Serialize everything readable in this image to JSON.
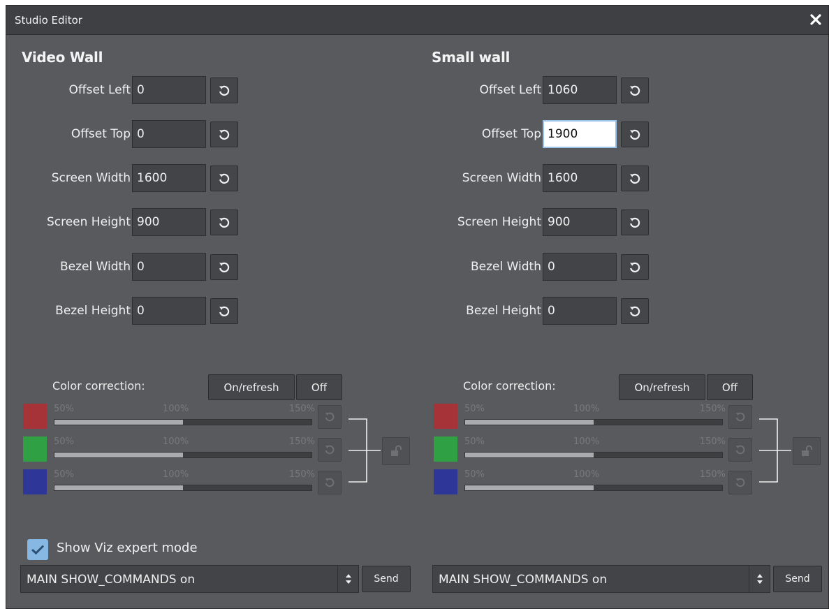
{
  "window": {
    "title": "Studio Editor"
  },
  "field_labels": [
    "Offset Left",
    "Offset Top",
    "Screen Width",
    "Screen Height",
    "Bezel Width",
    "Bezel Height"
  ],
  "panels": [
    {
      "title": "Video Wall",
      "fields": [
        {
          "label": "Offset Left",
          "value": "0"
        },
        {
          "label": "Offset Top",
          "value": "0"
        },
        {
          "label": "Screen Width",
          "value": "1600"
        },
        {
          "label": "Screen Height",
          "value": "900"
        },
        {
          "label": "Bezel Width",
          "value": "0"
        },
        {
          "label": "Bezel Height",
          "value": "0"
        }
      ],
      "color_correction": {
        "label": "Color correction:",
        "on_label": "On/refresh",
        "off_label": "Off",
        "ticks": [
          "50%",
          "100%",
          "150%"
        ],
        "channels": [
          {
            "name": "red",
            "color": "#a53338",
            "value_percent": 100
          },
          {
            "name": "green",
            "color": "#2fa043",
            "value_percent": 100
          },
          {
            "name": "blue",
            "color": "#2e3797",
            "value_percent": 100
          }
        ]
      },
      "command": {
        "value": "MAIN SHOW_COMMANDS on",
        "send_label": "Send"
      }
    },
    {
      "title": "Small wall",
      "fields": [
        {
          "label": "Offset Left",
          "value": "1060"
        },
        {
          "label": "Offset Top",
          "value": "1900"
        },
        {
          "label": "Screen Width",
          "value": "1600"
        },
        {
          "label": "Screen Height",
          "value": "900"
        },
        {
          "label": "Bezel Width",
          "value": "0"
        },
        {
          "label": "Bezel Height",
          "value": "0"
        }
      ],
      "color_correction": {
        "label": "Color correction:",
        "on_label": "On/refresh",
        "off_label": "Off",
        "ticks": [
          "50%",
          "100%",
          "150%"
        ],
        "channels": [
          {
            "name": "red",
            "color": "#a53338",
            "value_percent": 100
          },
          {
            "name": "green",
            "color": "#2fa043",
            "value_percent": 100
          },
          {
            "name": "blue",
            "color": "#2e3797",
            "value_percent": 100
          }
        ]
      },
      "command": {
        "value": "MAIN SHOW_COMMANDS on",
        "send_label": "Send"
      }
    }
  ],
  "expert_mode": {
    "label": "Show Viz expert mode",
    "checked": true
  },
  "focused_field": {
    "panel": 1,
    "field": "Offset Top"
  },
  "colors": {
    "background": "#585a5d",
    "titlebar": "#3f4043",
    "checkbox_accent": "#86b8e3",
    "focus_border": "#9cc4ea"
  },
  "icons": {
    "close": "close-icon",
    "reset": "reset-icon",
    "lock": "unlock-icon",
    "spinner": "spinner-arrows-icon",
    "check": "checkmark-icon"
  }
}
